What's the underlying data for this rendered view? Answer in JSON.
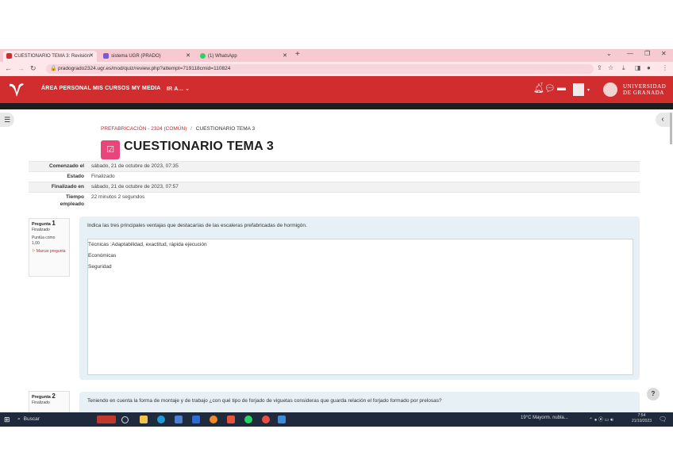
{
  "browser": {
    "tabs": [
      {
        "label": "CUESTIONARIO TEMA 3: Revisión",
        "favicon_color": "#d12c2e"
      },
      {
        "label": "sistema UGR (PRADO)",
        "favicon_color": "#7a5bd1"
      },
      {
        "label": "(1) WhatsApp",
        "favicon_color": "#25d366"
      }
    ],
    "new_tab": "+",
    "url": "pradogrado2324.ugr.es/mod/quiz/review.php?attempt=719118cmid=110824",
    "window_controls": [
      "⌄",
      "—",
      "❐",
      "✕"
    ]
  },
  "navbar": {
    "items": [
      "ÁREA PERSONAL",
      "MIS CURSOS",
      "MY MEDIA",
      "IR A... ⌄"
    ],
    "notification_count": "7",
    "university": [
      "UNIVERSIDAD",
      "DE GRANADA"
    ]
  },
  "breadcrumb": {
    "course": "PREFABRICACIÓN - 2324 (COMÚN)",
    "separator": "/",
    "current": "CUESTIONARIO TEMA 3"
  },
  "page_title": "CUESTIONARIO TEMA 3",
  "summary": [
    {
      "label": "Comenzado el",
      "value": "sábado, 21 de octubre de 2023, 07:35"
    },
    {
      "label": "Estado",
      "value": "Finalizado"
    },
    {
      "label": "Finalizado en",
      "value": "sábado, 21 de octubre de 2023, 07:57"
    },
    {
      "label": "Tiempo empleado",
      "value": "22 minutos 2 segundos"
    }
  ],
  "question1": {
    "prefix": "Pregunta",
    "number": "1",
    "state": "Finalizado",
    "marks": "Puntúa como 1,00",
    "flag": "Marcar pregunta",
    "text": "Indica las tres principales ventajas que destacarías de las escaleras prefabricadas de hormigón.",
    "answer_lines": [
      "Técnicas :Adaptabilidad, exactitud, rápida ejecución",
      "Económicas",
      "Seguridad"
    ]
  },
  "question2": {
    "prefix": "Pregunta",
    "number": "2",
    "state": "Finalizado",
    "text": "Teniendo en cuenta la forma de montaje y de trabajo ¿con qué tipo de forjado de viguetas consideras que guarda relación el forjado formado por prelosas?"
  },
  "help_label": "?",
  "taskbar": {
    "search": "Buscar",
    "weather": "19°C Mayorm. nubla...",
    "time": "7:54",
    "date": "21/10/2023"
  }
}
